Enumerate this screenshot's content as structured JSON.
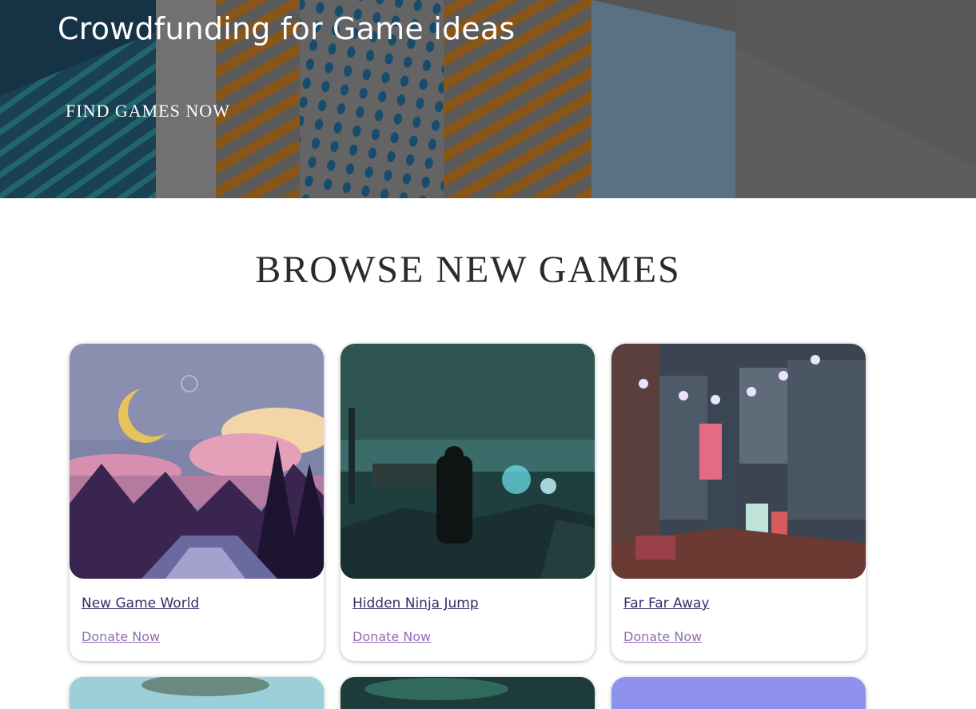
{
  "hero": {
    "title": "Crowdfunding for Game ideas",
    "cta_label": "FIND GAMES NOW"
  },
  "browse": {
    "title": "BROWSE NEW GAMES",
    "cards": [
      {
        "name": "New Game World",
        "donate_label": "Donate Now"
      },
      {
        "name": "Hidden Ninja Jump",
        "donate_label": "Donate Now"
      },
      {
        "name": "Far Far Away",
        "donate_label": "Donate Now"
      }
    ]
  },
  "colors": {
    "link": "#3b2a6b",
    "donate_link": "#8e6fb1",
    "hero_overlay": "#6b6b6b"
  }
}
